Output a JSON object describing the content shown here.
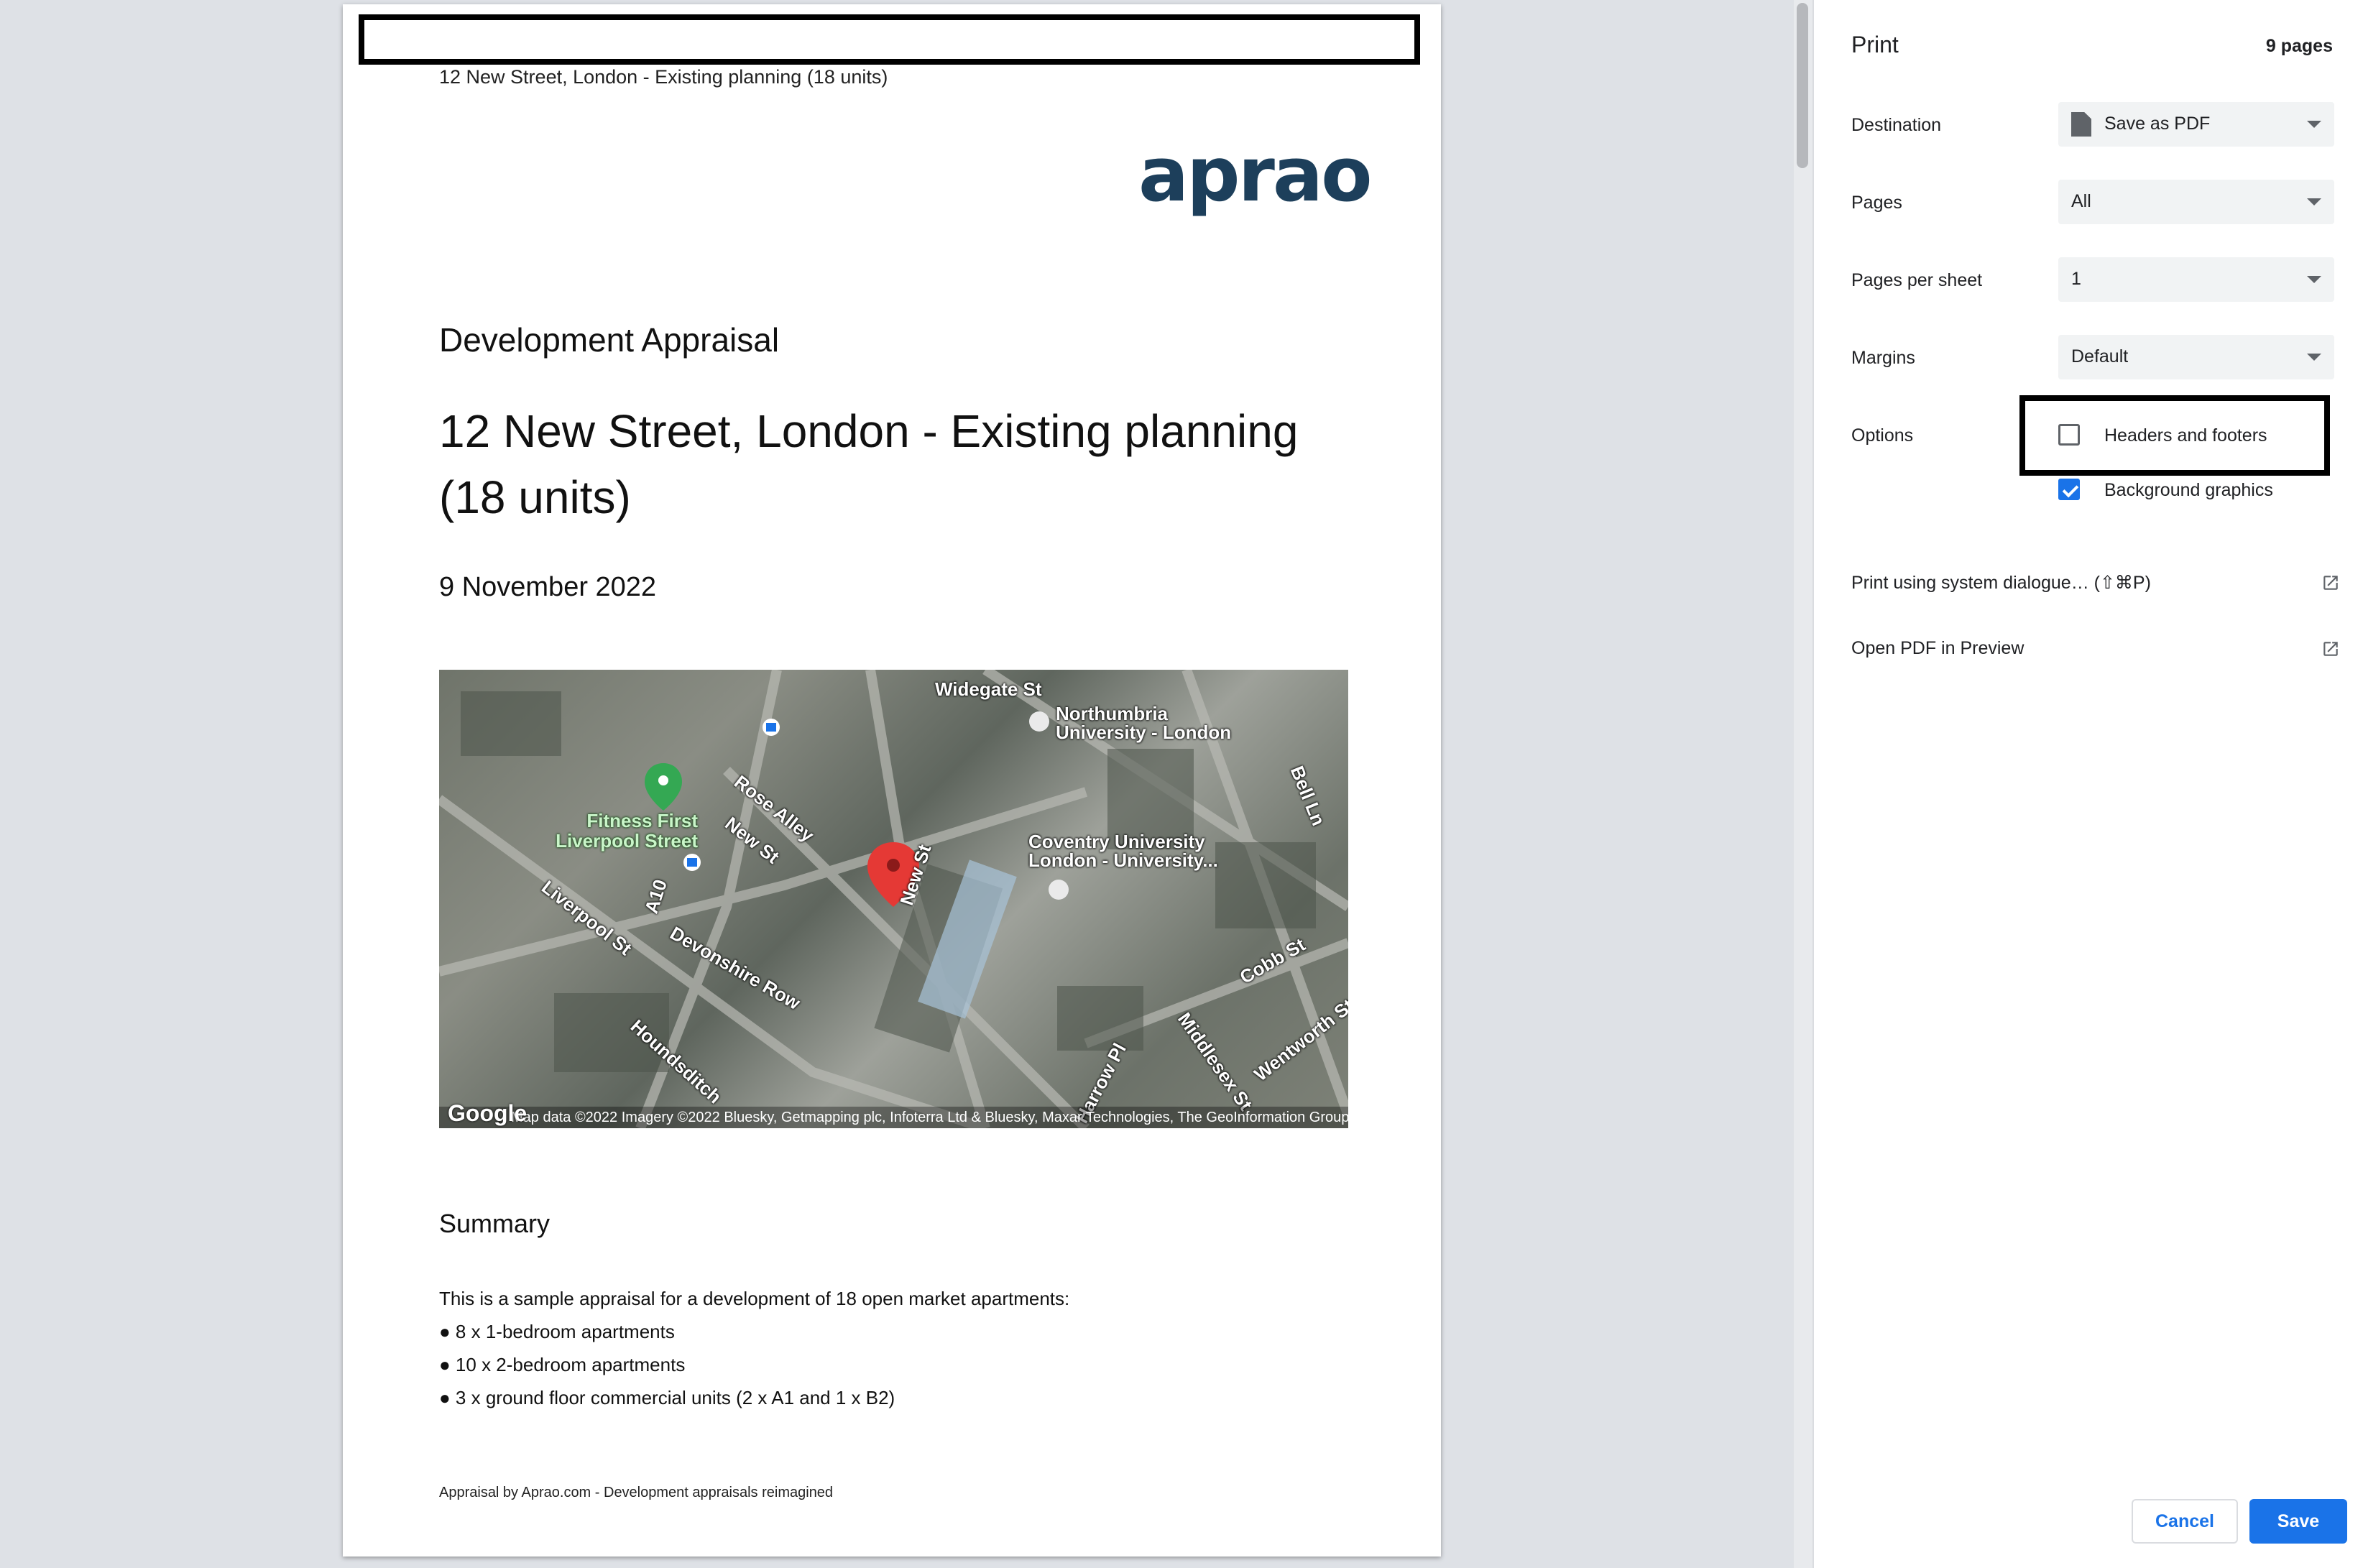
{
  "document": {
    "header_text": "12 New Street, London - Existing planning (18 units)",
    "logo_text": "aprao",
    "kind": "Development Appraisal",
    "title": "12 New Street, London - Existing planning (18 units)",
    "date": "9 November 2022",
    "map": {
      "labels": {
        "widegate": "Widegate St",
        "northumbria": "Northumbria University - London",
        "bell_ln": "Bell Ln",
        "fitness_first": "Fitness First Liverpool Street",
        "rose_alley": "Rose Alley",
        "new_st_1": "New St",
        "new_st_2": "New St",
        "coventry": "Coventry University London - University...",
        "liverpool_st": "Liverpool St",
        "a10": "A10",
        "devonshire_row": "Devonshire Row",
        "cobb_st": "Cobb St",
        "houndsditch": "Houndsditch",
        "wentworth_st": "Wentworth St",
        "middlesex_st": "Middlesex St",
        "harrow_pl": "Harrow Pl"
      },
      "google": "Google",
      "attribution": "Map data ©2022 Imagery ©2022 Bluesky, Getmapping plc, Infoterra Ltd & Bluesky, Maxar Technologies, The GeoInformation Group"
    },
    "summary_heading": "Summary",
    "summary_intro": "This is a sample appraisal for a development of 18 open market apartments:",
    "bullets": [
      "● 8 x 1-bedroom apartments",
      "● 10 x 2-bedroom apartments",
      "● 3 x ground floor commercial units (2 x A1 and 1 x B2)"
    ],
    "footer": "Appraisal by Aprao.com - Development appraisals reimagined"
  },
  "print_panel": {
    "title": "Print",
    "page_count": "9 pages",
    "destination": {
      "label": "Destination",
      "value": "Save as PDF",
      "icon": "document-icon"
    },
    "pages": {
      "label": "Pages",
      "value": "All"
    },
    "pages_per_sheet": {
      "label": "Pages per sheet",
      "value": "1"
    },
    "margins": {
      "label": "Margins",
      "value": "Default"
    },
    "options": {
      "label": "Options",
      "headers_footers": {
        "label": "Headers and footers",
        "checked": false
      },
      "background_graphics": {
        "label": "Background graphics",
        "checked": true
      }
    },
    "system_dialogue": "Print using system dialogue… (⇧⌘P)",
    "open_preview": "Open PDF in Preview",
    "cancel": "Cancel",
    "save": "Save"
  },
  "colors": {
    "accent": "#1a73e8",
    "logo": "#1d3f5b",
    "map_pin": "#e53935",
    "fitness_pin": "#34a853"
  }
}
